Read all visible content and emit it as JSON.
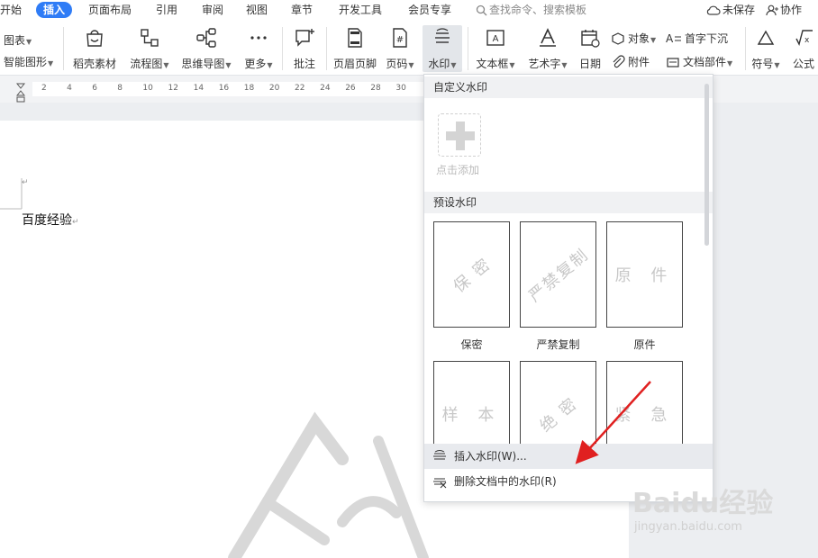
{
  "menubar": {
    "tabs": [
      "开始",
      "插入",
      "页面布局",
      "引用",
      "审阅",
      "视图",
      "章节",
      "开发工具",
      "会员专享"
    ],
    "active_tab": "插入",
    "search_placeholder": "查找命令、搜索模板",
    "unsaved": "未保存",
    "collab": "协作"
  },
  "ribbon": {
    "chart_label": "图表",
    "smart_shape_label": "智能图形",
    "buttons": {
      "shell_material": "稻壳素材",
      "flowchart": "流程图",
      "mindmap": "思维导图",
      "more": "更多",
      "comment": "批注",
      "header_footer": "页眉页脚",
      "page_number": "页码",
      "watermark": "水印",
      "textbox": "文本框",
      "wordart": "艺术字",
      "date": "日期",
      "object": "对象",
      "attachment": "附件",
      "dropcap": "首字下沉",
      "doc_parts": "文档部件",
      "symbol": "符号",
      "formula": "公式"
    }
  },
  "ruler": {
    "marks": [
      "2",
      "4",
      "6",
      "8",
      "10",
      "12",
      "14",
      "16",
      "18",
      "20",
      "22",
      "24",
      "26",
      "28",
      "30"
    ]
  },
  "document": {
    "text": "百度经验",
    "para_mark": "↵"
  },
  "watermark_panel": {
    "custom_header": "自定义水印",
    "add_label": "点击添加",
    "preset_header": "预设水印",
    "presets": [
      {
        "text": "保 密",
        "caption": "保密",
        "rotated": true
      },
      {
        "text": "严禁复制",
        "caption": "严禁复制",
        "rotated": true
      },
      {
        "text": "原 件",
        "caption": "原件",
        "rotated": false
      },
      {
        "text": "样 本",
        "caption": "",
        "rotated": false
      },
      {
        "text": "绝 密",
        "caption": "",
        "rotated": true
      },
      {
        "text": "紧 急",
        "caption": "",
        "rotated": false
      }
    ],
    "insert_action": "插入水印(W)...",
    "delete_action": "删除文档中的水印(R)"
  },
  "overlay": {
    "baidu_logo": "Baidu经验",
    "baidu_url": "jingyan.baidu.com",
    "arrow_color": "#e02020"
  }
}
